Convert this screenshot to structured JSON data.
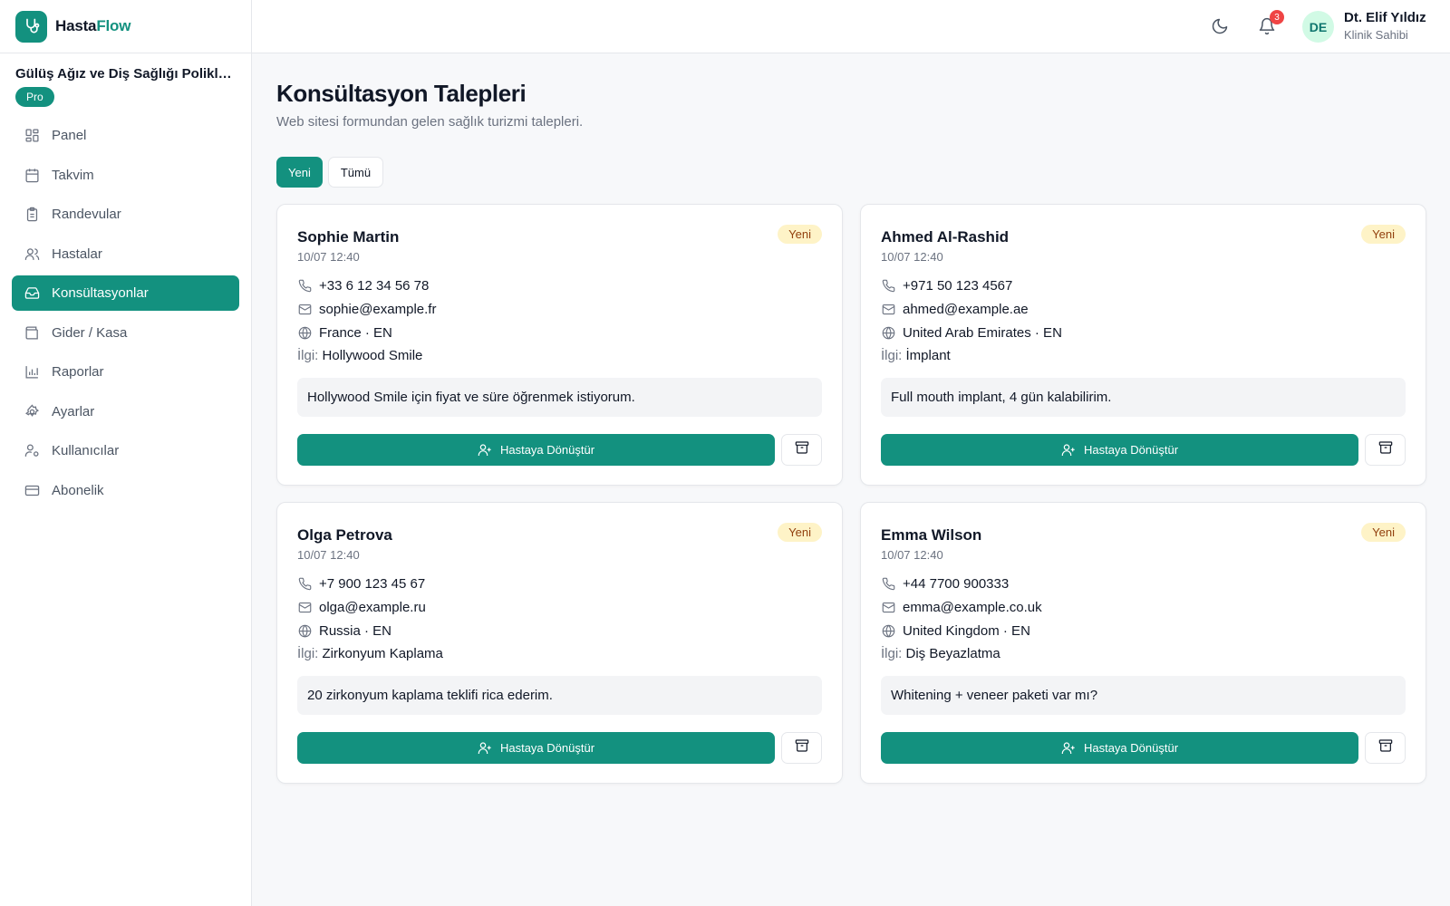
{
  "app": {
    "brand_part1": "Hasta",
    "brand_part2": "Flow",
    "accent_color": "#13917f"
  },
  "sidebar": {
    "clinic_name": "Gülüş Ağız ve Diş Sağlığı Poliklinikleri",
    "plan_badge": "Pro",
    "items": [
      {
        "label": "Panel",
        "icon": "grid-icon"
      },
      {
        "label": "Takvim",
        "icon": "calendar-icon"
      },
      {
        "label": "Randevular",
        "icon": "clipboard-icon"
      },
      {
        "label": "Hastalar",
        "icon": "users-icon"
      },
      {
        "label": "Konsültasyonlar",
        "icon": "inbox-icon",
        "active": true
      },
      {
        "label": "Gider / Kasa",
        "icon": "wallet-icon"
      },
      {
        "label": "Raporlar",
        "icon": "bar-chart-icon"
      },
      {
        "label": "Ayarlar",
        "icon": "gear-icon"
      },
      {
        "label": "Kullanıcılar",
        "icon": "user-cog-icon"
      },
      {
        "label": "Abonelik",
        "icon": "credit-card-icon"
      }
    ]
  },
  "topbar": {
    "theme_icon": "moon-icon",
    "notification_icon": "bell-icon",
    "notification_count": "3",
    "avatar_initials": "DE",
    "user_name": "Dt. Elif Yıldız",
    "user_role": "Klinik Sahibi"
  },
  "main": {
    "title": "Konsültasyon Talepleri",
    "subtitle": "Web sitesi formundan gelen sağlık turizmi talepleri.",
    "tabs": [
      {
        "label": "Yeni",
        "active": true
      },
      {
        "label": "Tümü",
        "active": false
      }
    ],
    "interest_label": "İlgi:",
    "convert_label": "Hastaya Dönüştür",
    "cards": [
      {
        "name": "Sophie Martin",
        "date": "10/07 12:40",
        "status": "Yeni",
        "phone": "+33 6 12 34 56 78",
        "email": "sophie@example.fr",
        "country": "France · EN",
        "interest": "Hollywood Smile",
        "message": "Hollywood Smile için fiyat ve süre öğrenmek istiyorum."
      },
      {
        "name": "Ahmed Al-Rashid",
        "date": "10/07 12:40",
        "status": "Yeni",
        "phone": "+971 50 123 4567",
        "email": "ahmed@example.ae",
        "country": "United Arab Emirates · EN",
        "interest": "İmplant",
        "message": "Full mouth implant, 4 gün kalabilirim."
      },
      {
        "name": "Olga Petrova",
        "date": "10/07 12:40",
        "status": "Yeni",
        "phone": "+7 900 123 45 67",
        "email": "olga@example.ru",
        "country": "Russia · EN",
        "interest": "Zirkonyum Kaplama",
        "message": "20 zirkonyum kaplama teklifi rica ederim."
      },
      {
        "name": "Emma Wilson",
        "date": "10/07 12:40",
        "status": "Yeni",
        "phone": "+44 7700 900333",
        "email": "emma@example.co.uk",
        "country": "United Kingdom · EN",
        "interest": "Diş Beyazlatma",
        "message": "Whitening + veneer paketi var mı?"
      }
    ]
  }
}
